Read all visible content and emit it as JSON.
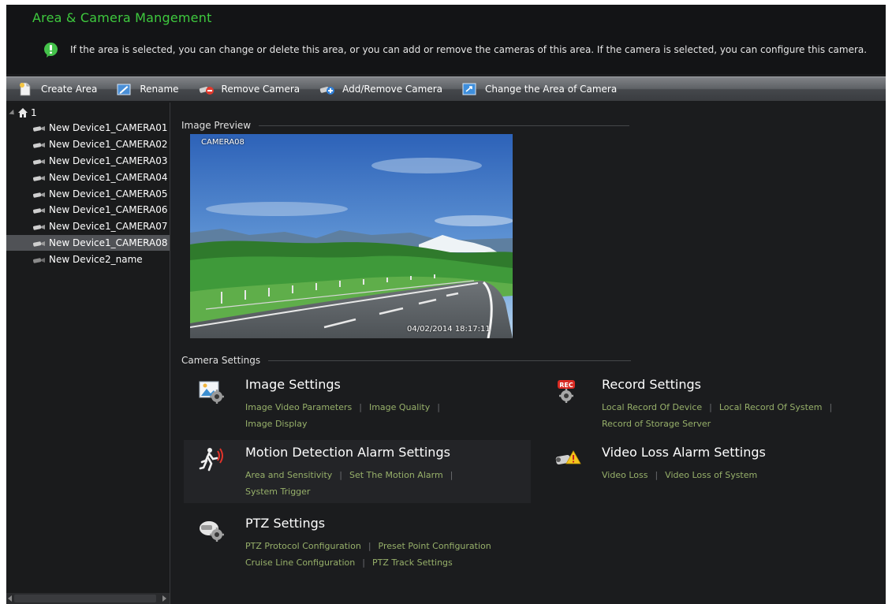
{
  "header": {
    "title": "Area & Camera Mangement",
    "tip": "If the area is selected, you can change or delete this area, or you can add or remove the cameras of this area. If the camera is selected, you can configure this camera."
  },
  "toolbar": {
    "create_area": "Create Area",
    "rename": "Rename",
    "remove_camera": "Remove Camera",
    "add_remove_camera": "Add/Remove Camera",
    "change_area": "Change the Area of Camera"
  },
  "tree": {
    "root_label": "1",
    "items": [
      {
        "label": "New Device1_CAMERA01"
      },
      {
        "label": "New Device1_CAMERA02"
      },
      {
        "label": "New Device1_CAMERA03"
      },
      {
        "label": "New Device1_CAMERA04"
      },
      {
        "label": "New Device1_CAMERA05"
      },
      {
        "label": "New Device1_CAMERA06"
      },
      {
        "label": "New Device1_CAMERA07"
      },
      {
        "label": "New Device1_CAMERA08"
      },
      {
        "label": "New Device2_name"
      }
    ],
    "selected_index": 7
  },
  "preview": {
    "section_title": "Image Preview",
    "camera_label": "CAMERA08",
    "timestamp": "04/02/2014  18:17:11"
  },
  "settings": {
    "section_title": "Camera Settings",
    "image": {
      "title": "Image Settings",
      "link1": "Image Video Parameters",
      "link2": "Image Quality",
      "link3": "Image Display"
    },
    "record": {
      "title": "Record Settings",
      "link1": "Local Record Of Device",
      "link2": "Local Record Of System",
      "link3": "Record of Storage Server"
    },
    "motion": {
      "title": "Motion Detection Alarm Settings",
      "link1": "Area and Sensitivity",
      "link2": "Set The Motion Alarm",
      "link3": "System Trigger"
    },
    "videoloss": {
      "title": "Video Loss Alarm Settings",
      "link1": "Video Loss",
      "link2": "Video Loss of System"
    },
    "ptz": {
      "title": "PTZ Settings",
      "link1": "PTZ Protocol Configuration",
      "link2": "Preset Point Configuration",
      "link3": "Cruise Line Configuration",
      "link4": "PTZ Track Settings"
    }
  },
  "colors": {
    "title_green": "#3ec93e",
    "link_green": "#97b06a",
    "background": "#1b1c1e",
    "selected_row": "#505256"
  }
}
